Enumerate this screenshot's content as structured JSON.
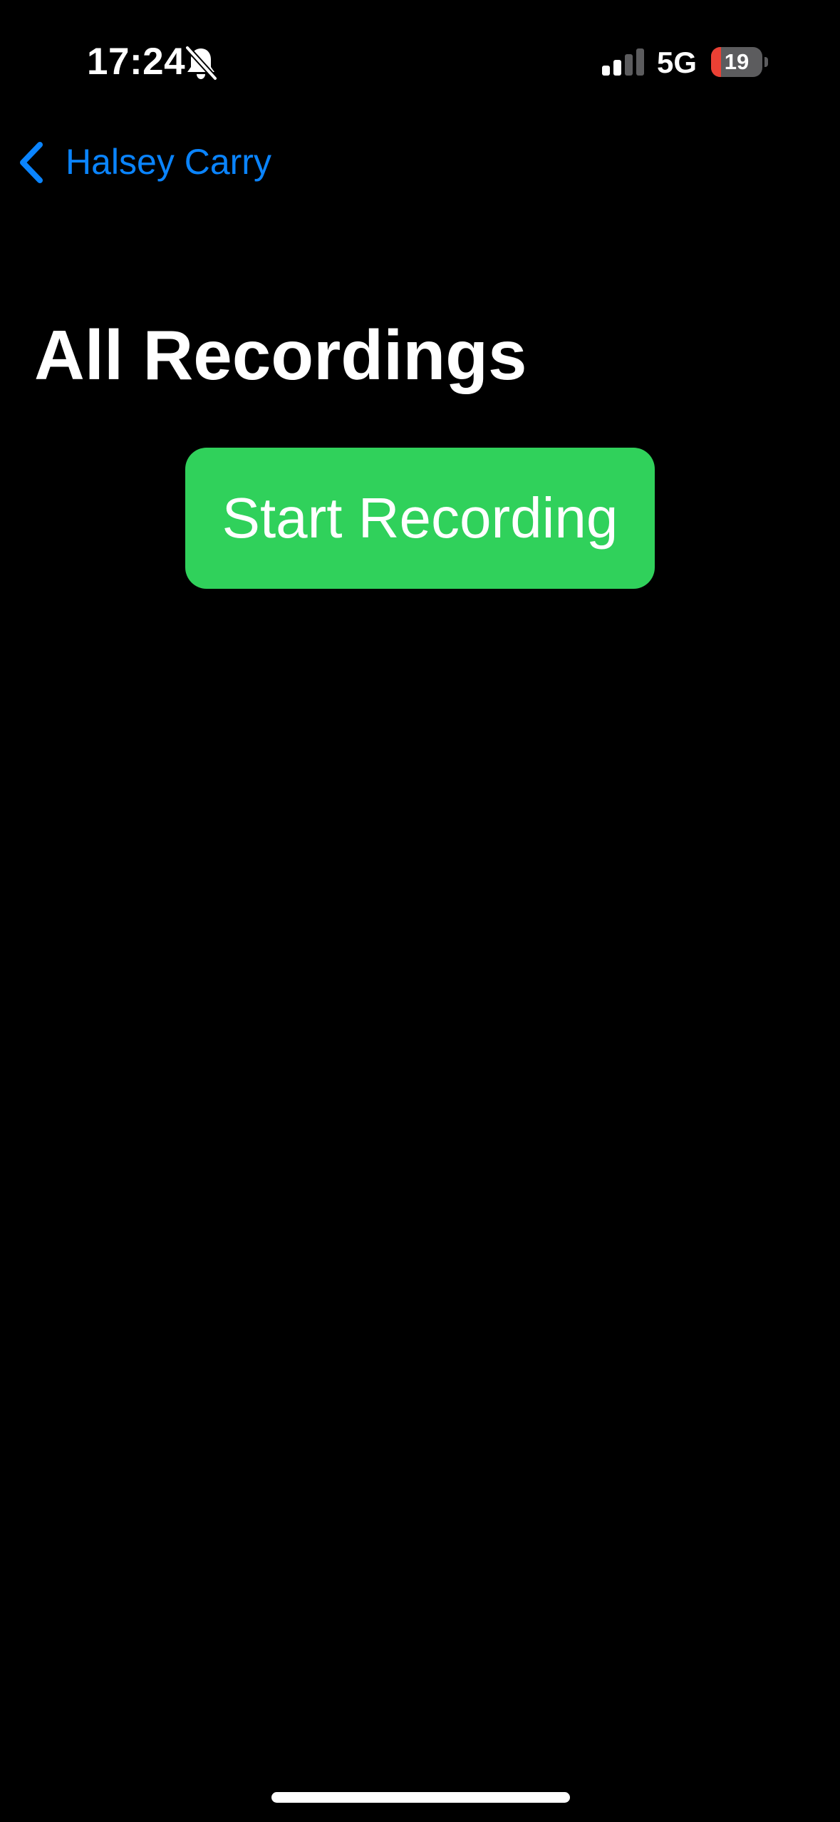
{
  "status_bar": {
    "time": "17:24",
    "silent_icon": "bell-slash-icon",
    "signal_icon": "cellular-signal-icon",
    "signal_bars_active": 2,
    "signal_bars_total": 4,
    "network": "5G",
    "battery_level": "19",
    "battery_fraction": 0.19,
    "battery_color": "#eb4034"
  },
  "nav": {
    "back_icon": "chevron-left-icon",
    "back_label": "Halsey Carry"
  },
  "main": {
    "title": "All Recordings",
    "start_button_label": "Start Recording"
  },
  "colors": {
    "background": "#000000",
    "accent_blue": "#0a84ff",
    "button_green": "#30d15b",
    "text": "#ffffff"
  }
}
